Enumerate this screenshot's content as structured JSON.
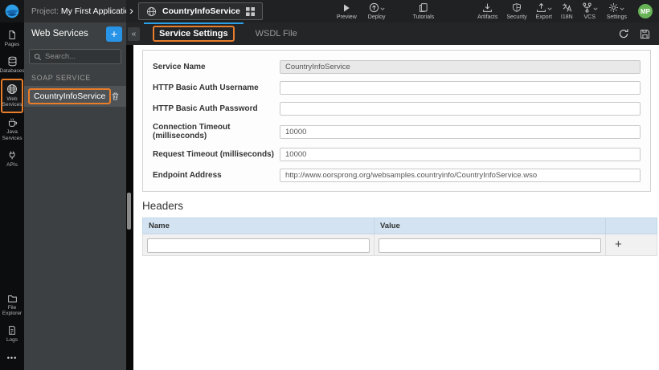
{
  "topbar": {
    "project_label": "Project:",
    "project_name": "My First Application",
    "service_tab_name": "CountryInfoService",
    "actions": {
      "preview": "Preview",
      "deploy": "Deploy",
      "tutorials": "Tutorials",
      "artifacts": "Artifacts",
      "security": "Security",
      "export": "Export",
      "i18n": "I18N",
      "vcs": "VCS",
      "settings": "Settings"
    },
    "avatar_initials": "MP"
  },
  "sidebar": {
    "items": [
      {
        "label": "Pages"
      },
      {
        "label": "Databases"
      },
      {
        "label": "Web Services",
        "active": true
      },
      {
        "label": "Java Services"
      },
      {
        "label": "APIs"
      }
    ],
    "bottom_items": [
      {
        "label": "File Explorer"
      },
      {
        "label": "Logs"
      }
    ]
  },
  "panel": {
    "title": "Web Services",
    "search_placeholder": "Search...",
    "section": "SOAP SERVICE",
    "items": [
      {
        "name": "CountryInfoService"
      }
    ]
  },
  "main": {
    "tabs": [
      {
        "label": "Service Settings",
        "active": true
      },
      {
        "label": "WSDL File"
      }
    ],
    "form": {
      "fields": [
        {
          "label": "Service Name",
          "value": "CountryInfoService",
          "disabled": true
        },
        {
          "label": "HTTP Basic Auth Username",
          "value": ""
        },
        {
          "label": "HTTP Basic Auth Password",
          "value": ""
        },
        {
          "label": "Connection Timeout (milliseconds)",
          "value": "10000"
        },
        {
          "label": "Request Timeout (milliseconds)",
          "value": "10000"
        },
        {
          "label": "Endpoint Address",
          "value": "http://www.oorsprong.org/websamples.countryinfo/CountryInfoService.wso"
        }
      ]
    },
    "headers_section": {
      "title": "Headers",
      "columns": {
        "name": "Name",
        "value": "Value"
      },
      "row": {
        "name_value": "",
        "value_value": ""
      },
      "add_label": "+"
    }
  },
  "icons": {
    "breadcrumb_chevron": "›",
    "collapse": "«",
    "add": "+",
    "ellipsis": "•••"
  },
  "colors": {
    "annotation_orange": "#e87d2a",
    "accent_blue": "#2794e8",
    "active_tab_underline": "#2aa1e8",
    "avatar_green": "#67b356",
    "table_header_blue": "#d3e3f1"
  }
}
